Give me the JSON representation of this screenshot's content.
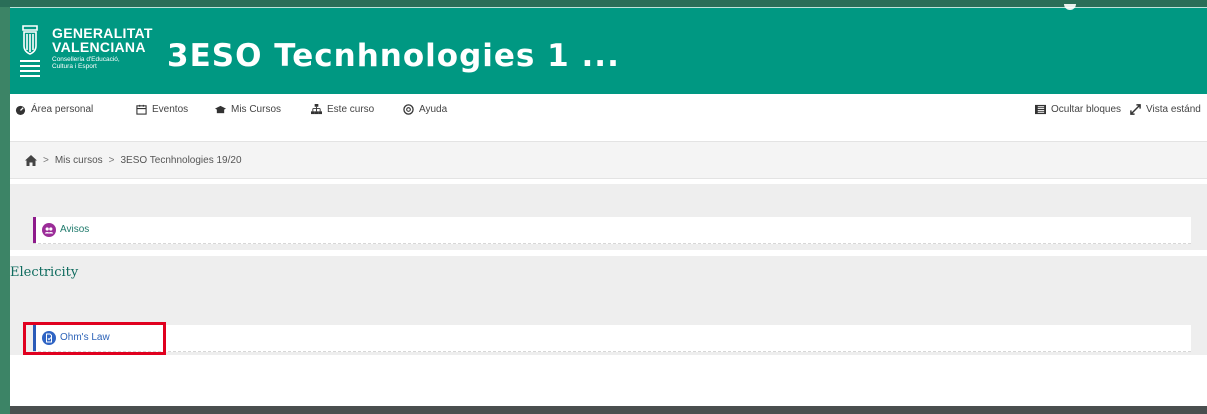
{
  "header": {
    "logo": {
      "line1": "GENERALITAT",
      "line2": "VALENCIANA",
      "line3": "Conselleria d'Educació,",
      "line4": "Cultura i Esport"
    },
    "site_title": "3ESO Tecnhnologies 1 ..."
  },
  "navbar": {
    "items": [
      {
        "label": "Área personal",
        "icon": "dashboard-icon"
      },
      {
        "label": "Eventos",
        "icon": "calendar-icon"
      },
      {
        "label": "Mis Cursos",
        "icon": "courses-icon"
      },
      {
        "label": "Este curso",
        "icon": "sitemap-icon"
      },
      {
        "label": "Ayuda",
        "icon": "lifebuoy-icon"
      }
    ],
    "right": [
      {
        "label": "Ocultar bloques",
        "icon": "hide-blocks-icon"
      },
      {
        "label": "Vista estánd",
        "icon": "expand-icon"
      }
    ]
  },
  "breadcrumb": {
    "home_icon": "home-icon",
    "separator": ">",
    "items": [
      "Mis cursos",
      "3ESO Tecnhnologies 19/20"
    ]
  },
  "sections": [
    {
      "title": "",
      "activities": [
        {
          "label": "Avisos",
          "icon": "forum-icon",
          "accent": "#8e1a8b"
        }
      ]
    },
    {
      "title": "Electricity",
      "activities": [
        {
          "label": "Ohm's Law",
          "icon": "assignment-icon",
          "accent": "#2a5ab8"
        }
      ]
    }
  ],
  "colors": {
    "header": "#009882",
    "highlight": "#e0001f",
    "link": "#1f7a6c"
  }
}
